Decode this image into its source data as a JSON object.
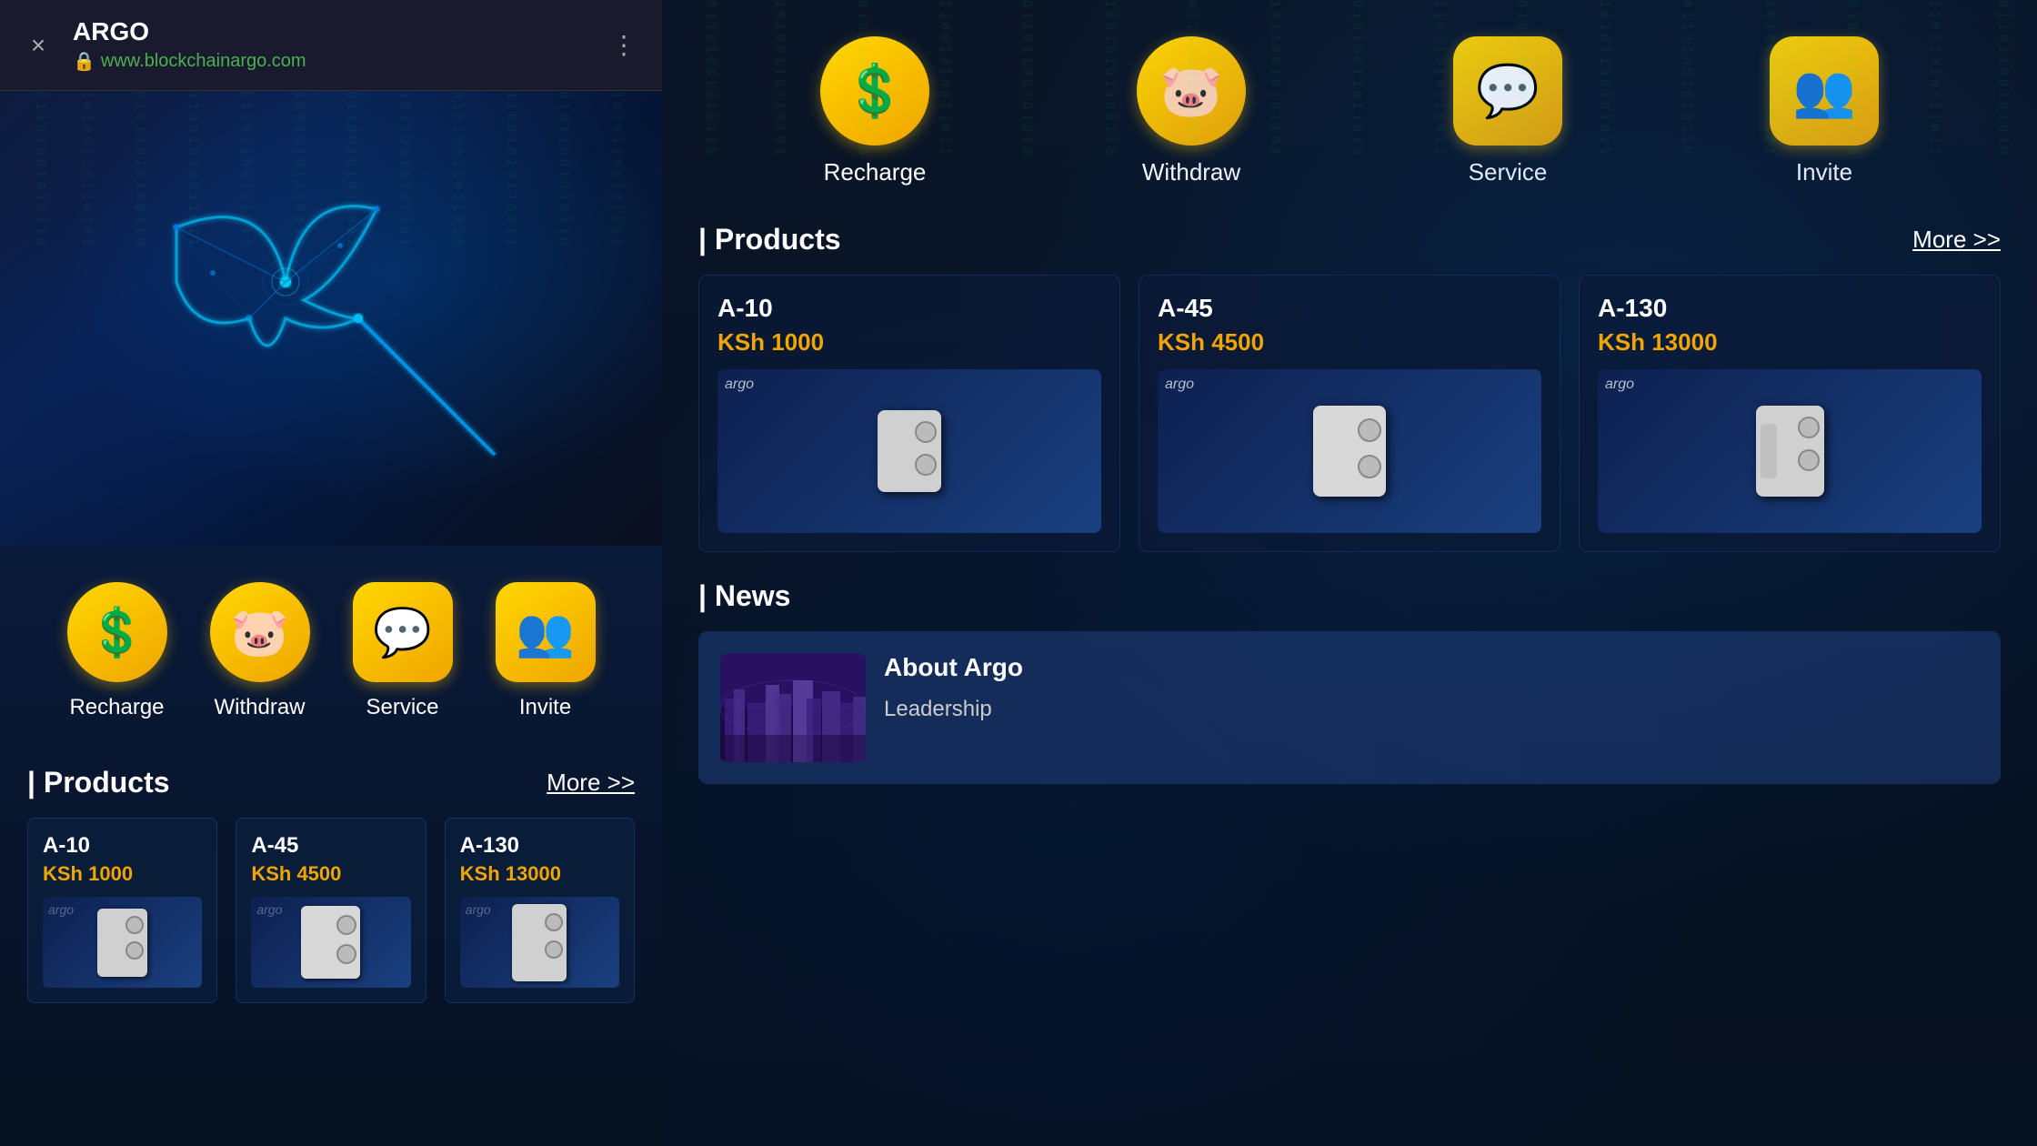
{
  "browser": {
    "title": "ARGO",
    "url": "www.blockchainargo.com",
    "close_label": "×",
    "menu_label": "⋮"
  },
  "left": {
    "action_buttons": [
      {
        "id": "recharge",
        "label": "Recharge",
        "icon": "💲",
        "shape": "circle"
      },
      {
        "id": "withdraw",
        "label": "Withdraw",
        "icon": "🐷",
        "shape": "circle"
      },
      {
        "id": "service",
        "label": "Service",
        "icon": "💬",
        "shape": "square"
      },
      {
        "id": "invite",
        "label": "Invite",
        "icon": "👥",
        "shape": "square"
      }
    ],
    "products_title": "Products",
    "more_label": "More >>",
    "products": [
      {
        "name": "A-10",
        "price": "KSh 1000"
      },
      {
        "name": "A-45",
        "price": "KSh 4500"
      },
      {
        "name": "A-130",
        "price": "KSh 13000"
      }
    ]
  },
  "right": {
    "action_buttons": [
      {
        "id": "recharge",
        "label": "Recharge",
        "icon": "💲",
        "shape": "circle"
      },
      {
        "id": "withdraw",
        "label": "Withdraw",
        "icon": "🐷",
        "shape": "circle"
      },
      {
        "id": "service",
        "label": "Service",
        "icon": "💬",
        "shape": "square"
      },
      {
        "id": "invite",
        "label": "Invite",
        "icon": "👥",
        "shape": "square"
      }
    ],
    "products_title": "Products",
    "more_label": "More >>",
    "products": [
      {
        "name": "A-10",
        "price": "KSh 1000"
      },
      {
        "name": "A-45",
        "price": "KSh 4500"
      },
      {
        "name": "A-130",
        "price": "KSh 13000"
      }
    ],
    "news_title": "News",
    "news_items": [
      {
        "title": "About Argo",
        "subtitle": "Leadership"
      }
    ]
  }
}
